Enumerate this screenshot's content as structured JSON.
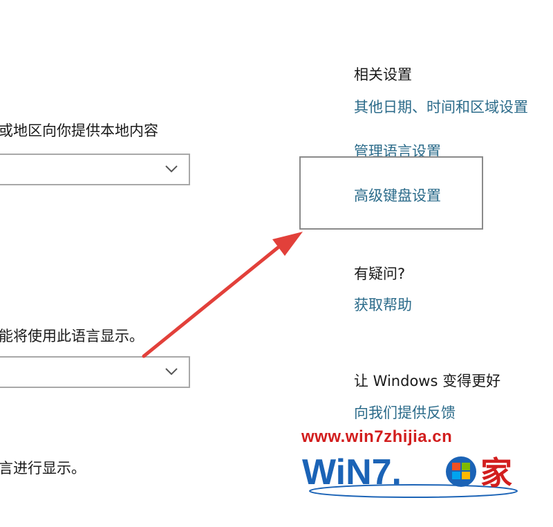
{
  "left_panel": {
    "region_desc": "或地区向你提供本地内容",
    "language_desc": "能将使用此语言显示。",
    "bottom_desc": "言进行显示。"
  },
  "related": {
    "heading": "相关设置",
    "links": [
      "其他日期、时间和区域设置",
      "管理语言设置",
      "高级键盘设置"
    ]
  },
  "help": {
    "heading": "有疑问?",
    "link": "获取帮助"
  },
  "feedback": {
    "heading": "让 Windows 变得更好",
    "link": "向我们提供反馈"
  },
  "watermark": {
    "url": "www.win7zhijia.cn",
    "logo_text": "WiN7.",
    "logo_char": "家"
  },
  "colors": {
    "link": "#2b6b8a",
    "arrow": "#e2403a",
    "watermark_red": "#d21e1e",
    "watermark_blue": "#1b63b6"
  },
  "icons": [
    "chevron-down-icon",
    "red-arrow-annotation",
    "windows-flag-icon"
  ]
}
